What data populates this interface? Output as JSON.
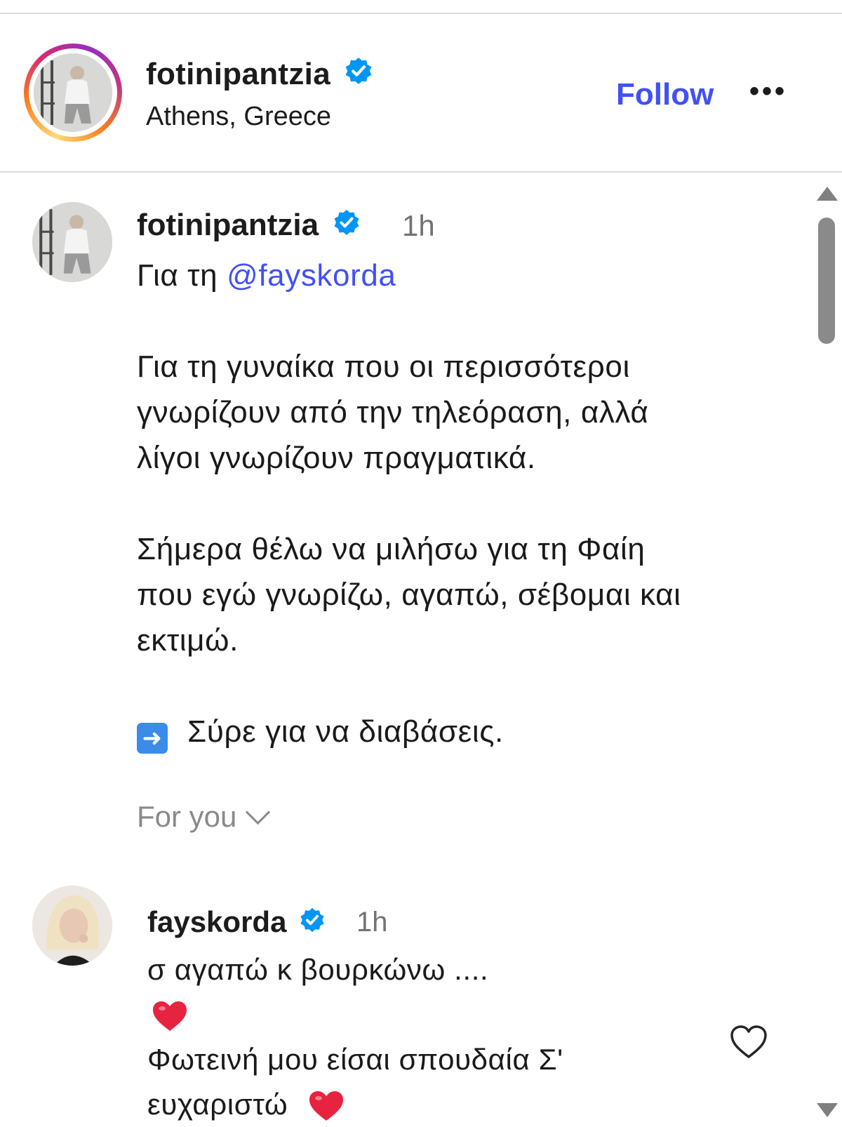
{
  "header": {
    "username": "fotinipantzia",
    "location": "Athens, Greece",
    "follow_label": "Follow",
    "more_label": "•••",
    "verified_color": "#0095f6"
  },
  "caption": {
    "username": "fotinipantzia",
    "time": "1h",
    "line1_prefix": "Για τη ",
    "mention": "@fayskorda",
    "paragraph1": [
      "Για τη γυναίκα που οι περισσότεροι",
      "γνωρίζουν από την τηλεόραση, αλλά",
      "λίγοι γνωρίζουν πραγματικά."
    ],
    "paragraph2": [
      "Σήμερα θέλω να μιλήσω για τη Φαίη",
      "που εγώ γνωρίζω, αγαπώ, σέβομαι και",
      "εκτιμώ."
    ],
    "arrow_icon": "right-arrow-emoji",
    "swipe_text": "Σύρε για να διαβάσεις."
  },
  "feed_filter": {
    "label": "For you"
  },
  "comment": {
    "username": "fayskorda",
    "time": "1h",
    "line1": "σ αγαπώ κ βουρκώνω ....",
    "heart_icon": "red-heart-emoji",
    "line3": "Φωτεινή μου είσαι σπουδαία Σ'",
    "line4": "ευχαριστώ",
    "heart_color": "#e8233f"
  },
  "colors": {
    "link": "#4150f7",
    "muted": "#737373",
    "divider": "#dbdbdb"
  }
}
